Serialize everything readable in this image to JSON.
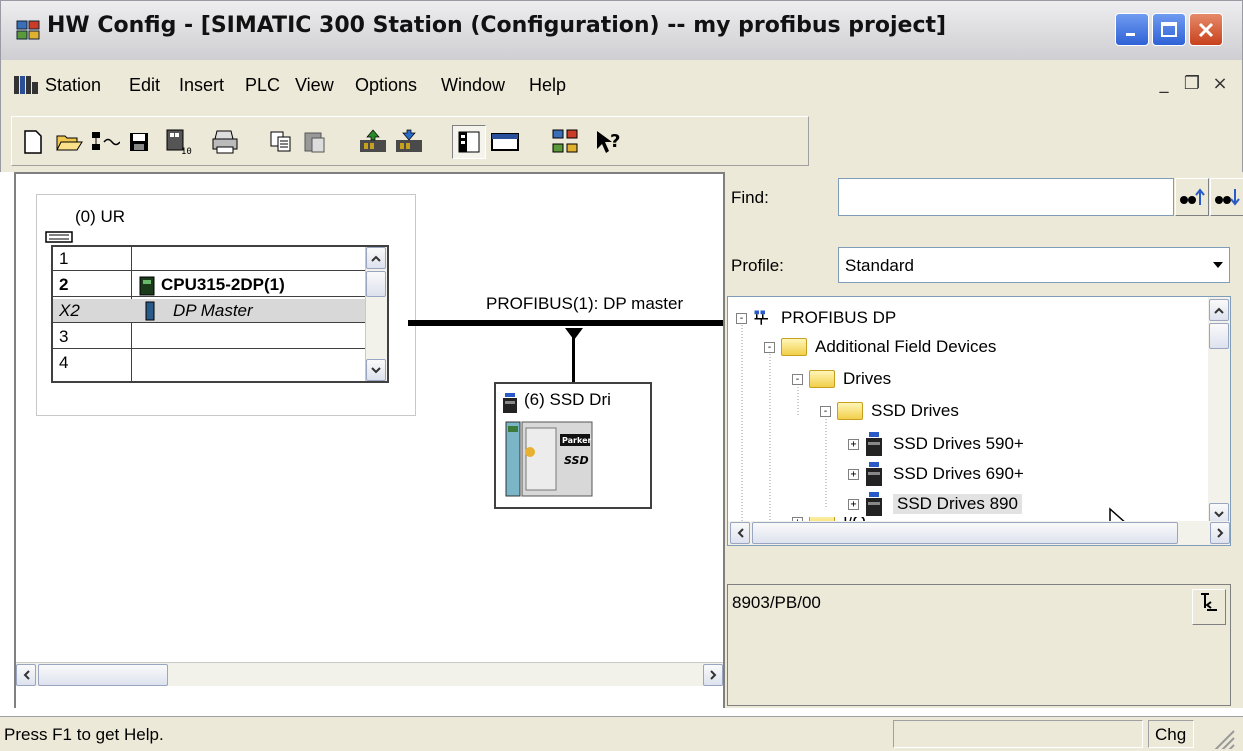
{
  "window": {
    "title": "HW Config - [SIMATIC 300 Station (Configuration) -- my profibus project]",
    "app_icon": "hw-config-icon"
  },
  "menu": {
    "items": [
      "Station",
      "Edit",
      "Insert",
      "PLC",
      "View",
      "Options",
      "Window",
      "Help"
    ],
    "mdi_buttons": [
      "_",
      "❐",
      "×"
    ]
  },
  "toolbar": {
    "buttons": [
      "new-icon",
      "open-icon",
      "save-compile-icon",
      "save-icon",
      "download-icon",
      "print-icon",
      "copy-icon",
      "paste-icon",
      "upload-icon",
      "download-module-icon",
      "catalog-icon",
      "station-view-icon",
      "network-icon",
      "help-icon"
    ]
  },
  "station": {
    "rack_title": "(0) UR",
    "rack_rows": [
      {
        "slot": "1",
        "module": ""
      },
      {
        "slot": "2",
        "module": "CPU315-2DP(1)"
      },
      {
        "slot": "X2",
        "module": "DP Master"
      },
      {
        "slot": "3",
        "module": ""
      },
      {
        "slot": "4",
        "module": ""
      }
    ],
    "network_label": "PROFIBUS(1): DP master",
    "slave_label": "(6) SSD Dri"
  },
  "catalog": {
    "find_label": "Find:",
    "find_value": "",
    "profile_label": "Profile:",
    "profile_value": "Standard",
    "tree": [
      {
        "label": "PROFIBUS DP",
        "level": 0,
        "expander": "-",
        "icon": "network-icon"
      },
      {
        "label": "Additional Field Devices",
        "level": 1,
        "expander": "-",
        "icon": "folder-icon"
      },
      {
        "label": "Drives",
        "level": 2,
        "expander": "-",
        "icon": "folder-icon"
      },
      {
        "label": "SSD Drives",
        "level": 3,
        "expander": "-",
        "icon": "folder-icon"
      },
      {
        "label": "SSD Drives 590+",
        "level": 4,
        "expander": "+",
        "icon": "device-icon"
      },
      {
        "label": "SSD Drives 690+",
        "level": 4,
        "expander": "+",
        "icon": "device-icon"
      },
      {
        "label": "SSD Drives 890",
        "level": 4,
        "expander": "+",
        "icon": "device-icon",
        "selected": true
      },
      {
        "label": "I/O",
        "level": 2,
        "expander": "+",
        "icon": "folder-icon"
      }
    ],
    "info_text": "8903/PB/00"
  },
  "status": {
    "text": "Press F1 to get Help.",
    "chg": "Chg"
  }
}
